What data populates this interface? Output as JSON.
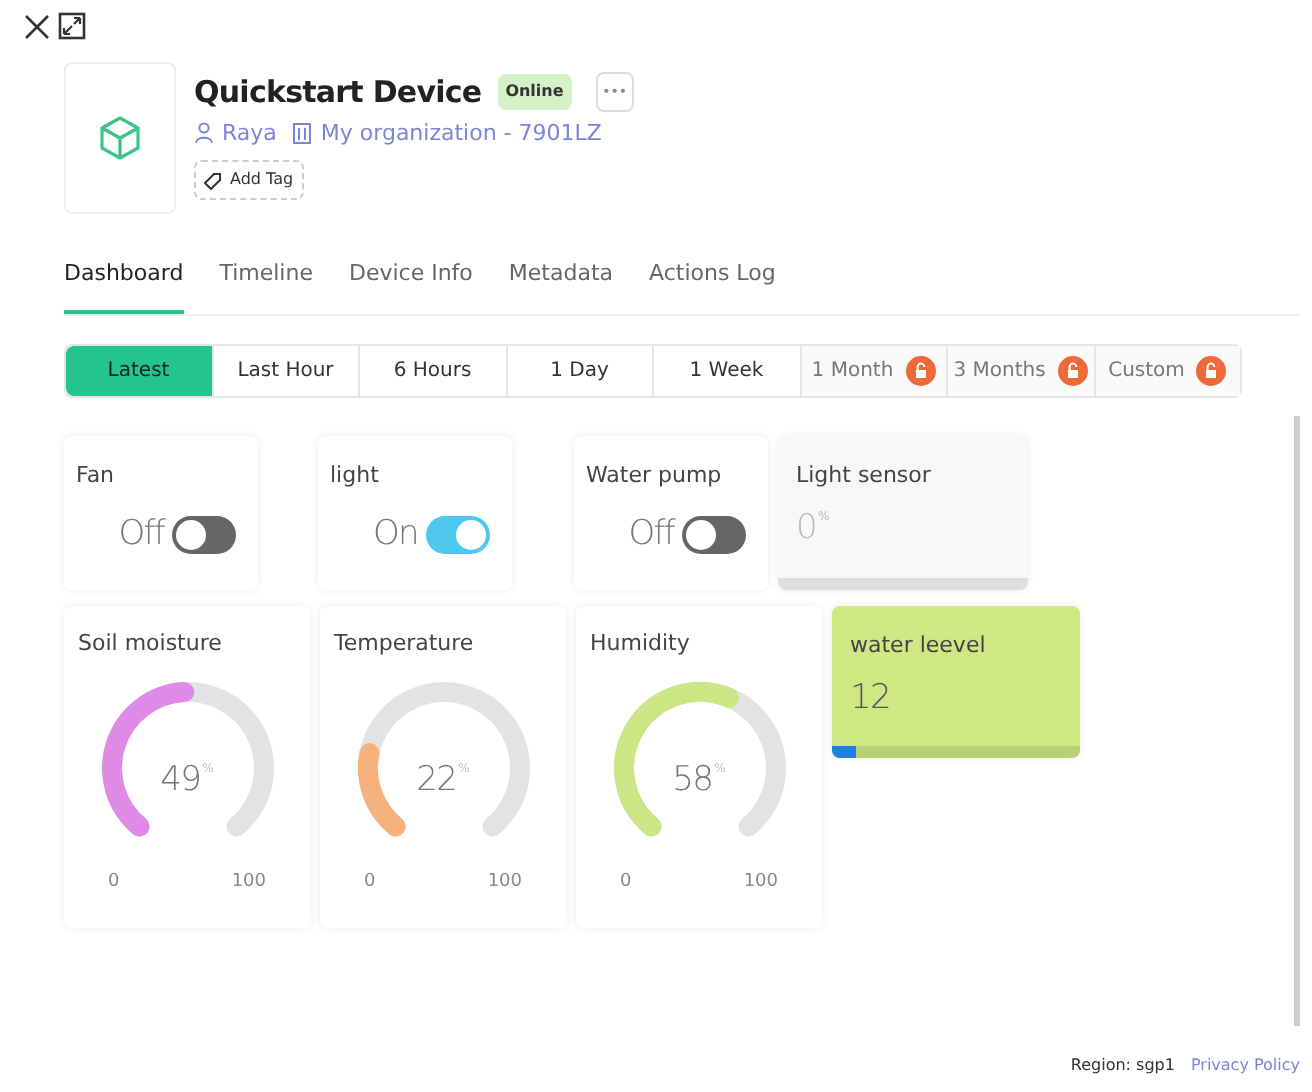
{
  "device": {
    "name": "Quickstart Device",
    "status": "Online",
    "owner": "Raya",
    "organization": "My organization - 7901LZ",
    "add_tag": "Add Tag",
    "more": "•••"
  },
  "tabs": [
    {
      "label": "Dashboard",
      "selected": true
    },
    {
      "label": "Timeline",
      "selected": false
    },
    {
      "label": "Device Info",
      "selected": false
    },
    {
      "label": "Metadata",
      "selected": false
    },
    {
      "label": "Actions Log",
      "selected": false
    }
  ],
  "time_ranges": [
    {
      "label": "Latest",
      "selected": true,
      "locked": false
    },
    {
      "label": "Last Hour",
      "selected": false,
      "locked": false
    },
    {
      "label": "6 Hours",
      "selected": false,
      "locked": false
    },
    {
      "label": "1 Day",
      "selected": false,
      "locked": false
    },
    {
      "label": "1 Week",
      "selected": false,
      "locked": false
    },
    {
      "label": "1 Month",
      "selected": false,
      "locked": true
    },
    {
      "label": "3 Months",
      "selected": false,
      "locked": true
    },
    {
      "label": "Custom",
      "selected": false,
      "locked": true
    }
  ],
  "widgets_row_1": [
    {
      "kind": "switch",
      "title": "Fan",
      "state_label": "Off",
      "on": false
    },
    {
      "kind": "switch",
      "title": "light",
      "state_label": "On",
      "on": true
    },
    {
      "kind": "switch",
      "title": "Water pump",
      "state_label": "Off",
      "on": false
    },
    {
      "kind": "value",
      "title": "Light sensor",
      "value": "0",
      "unit": "%"
    }
  ],
  "widgets_row_2": [
    {
      "kind": "gauge",
      "title": "Soil moisture",
      "value": "49",
      "unit": "%",
      "min": "0",
      "max": "100",
      "color": "#e08ae8"
    },
    {
      "kind": "gauge",
      "title": "Temperature",
      "value": "22",
      "unit": "%",
      "min": "0",
      "max": "100",
      "color": "#f5b27c"
    },
    {
      "kind": "gauge",
      "title": "Humidity",
      "value": "58",
      "unit": "%",
      "min": "0",
      "max": "100",
      "color": "#cbe684"
    },
    {
      "kind": "value",
      "title": "water leevel",
      "value": "12",
      "level": 0.1,
      "color": "#d0e884"
    }
  ],
  "footer": {
    "region": "Region: sgp1",
    "privacy": "Privacy Policy"
  }
}
